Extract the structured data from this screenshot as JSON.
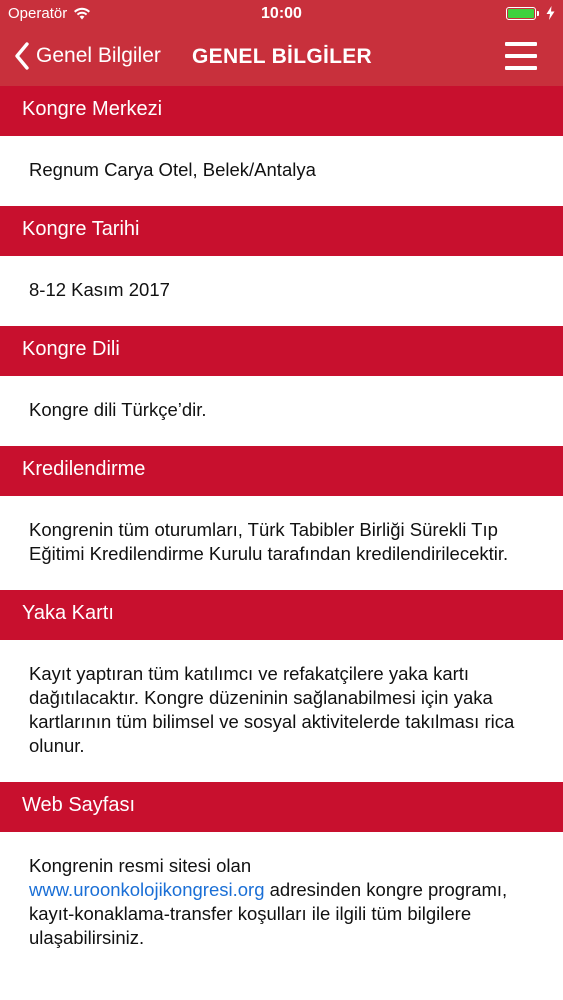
{
  "status_bar": {
    "carrier": "Operatör",
    "time": "10:00",
    "battery_level": 1.0,
    "wifi_icon": "wifi-icon",
    "battery_icon": "battery-icon",
    "charging_icon": "bolt-icon"
  },
  "nav": {
    "back_label": "Genel Bilgiler",
    "title": "GENEL BİLGİLER",
    "back_icon": "chevron-left-icon",
    "menu_icon": "hamburger-menu-icon"
  },
  "colors": {
    "header_red": "#c8102e",
    "nav_red": "#c8303c",
    "link_blue": "#1a6fd6"
  },
  "sections": [
    {
      "title": "Kongre Merkezi",
      "body": "Regnum Carya Otel, Belek/Antalya"
    },
    {
      "title": "Kongre Tarihi",
      "body": "8-12 Kasım 2017"
    },
    {
      "title": "Kongre Dili",
      "body": "Kongre dili Türkçe’dir."
    },
    {
      "title": "Kredilendirme",
      "body": "Kongrenin tüm oturumları, Türk Tabibler Birliği Sürekli Tıp Eğitimi Kredilendirme Kurulu tarafından kredilendirilecektir."
    },
    {
      "title": "Yaka Kartı",
      "body": "Kayıt yaptıran tüm katılımcı ve refakatçilere yaka kartı dağıtılacaktır. Kongre düzeninin sağlanabilmesi için yaka kartlarının tüm bilimsel ve sosyal aktivitelerde takılması rica olunur."
    },
    {
      "title": "Web Sayfası",
      "body_before": "Kongrenin resmi sitesi olan",
      "link": "www.uroonkolojikongresi.org",
      "body_after": "adresinden kongre programı, kayıt-konaklama-transfer koşulları ile ilgili tüm bilgilere ulaşabilirsiniz."
    }
  ]
}
